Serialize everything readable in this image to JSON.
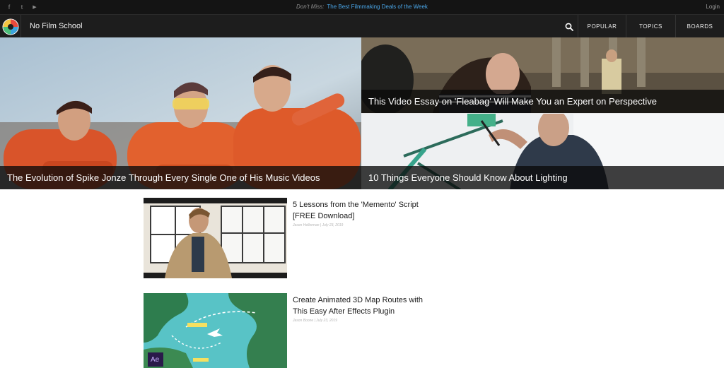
{
  "topbar": {
    "social": [
      {
        "name": "facebook",
        "glyph": "f"
      },
      {
        "name": "twitter",
        "glyph": "t"
      },
      {
        "name": "youtube",
        "glyph": "▶"
      }
    ],
    "dont_miss_label": "Don't Miss:",
    "dont_miss_link": "The Best Filmmaking Deals of the Week",
    "login": "Login"
  },
  "nav": {
    "brand": "No Film School",
    "items": [
      "POPULAR",
      "TOPICS",
      "BOARDS"
    ]
  },
  "hero": {
    "main": {
      "title": "The Evolution of Spike Jonze Through Every Single One of His Music Videos"
    },
    "right_top": {
      "title": "This Video Essay on 'Fleabag' Will Make You an Expert on Perspective"
    },
    "right_bottom": {
      "title": "10 Things Everyone Should Know About Lighting"
    }
  },
  "articles": [
    {
      "title": "5 Lessons from the 'Memento' Script [FREE Download]",
      "meta": "Jason Hellerman | July 23, 2019"
    },
    {
      "title": "Create Animated 3D Map Routes with This Easy After Effects Plugin",
      "meta": "Jason Boone | July 23, 2019",
      "badge": "Ae"
    }
  ],
  "colors": {
    "accent_link": "#4aa6e8",
    "topbar_bg": "#141414",
    "nav_bg": "#1d1d1d"
  }
}
